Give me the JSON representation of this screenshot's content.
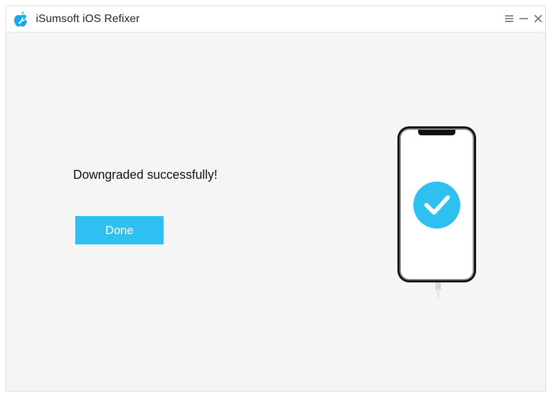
{
  "window": {
    "title": "iSumsoft iOS Refixer"
  },
  "icons": {
    "app": "apple-wrench-logo-icon",
    "menu": "menu-icon",
    "minimize": "minimize-icon",
    "close": "close-icon",
    "phone": "phone-illustration",
    "check": "check-circle-icon"
  },
  "main": {
    "status_message": "Downgraded successfully!",
    "done_label": "Done"
  },
  "colors": {
    "accent": "#2ec0f1",
    "background": "#f6f5f6",
    "titlebar": "#ffffff"
  }
}
